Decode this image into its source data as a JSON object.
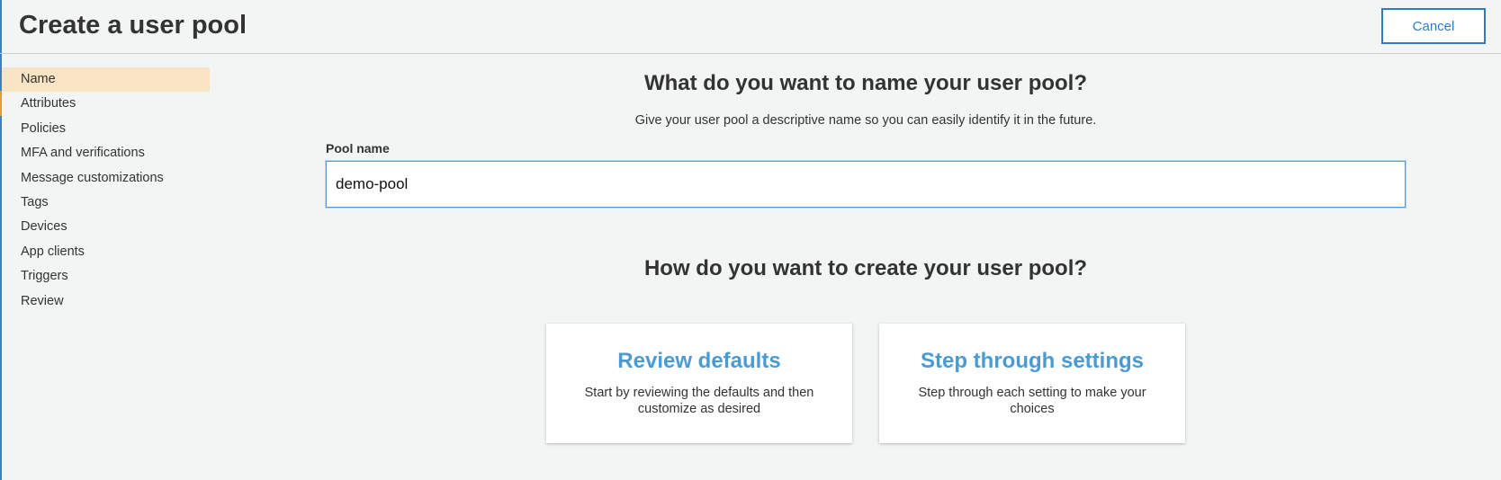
{
  "header": {
    "title": "Create a user pool",
    "cancel_label": "Cancel"
  },
  "sidebar": {
    "active": "Name",
    "items": [
      {
        "label": "Name"
      },
      {
        "label": "Attributes"
      },
      {
        "label": "Policies"
      },
      {
        "label": "MFA and verifications"
      },
      {
        "label": "Message customizations"
      },
      {
        "label": "Tags"
      },
      {
        "label": "Devices"
      },
      {
        "label": "App clients"
      },
      {
        "label": "Triggers"
      },
      {
        "label": "Review"
      }
    ]
  },
  "main": {
    "name_heading": "What do you want to name your user pool?",
    "name_description": "Give your user pool a descriptive name so you can easily identify it in the future.",
    "pool_name_label": "Pool name",
    "pool_name_value": "demo-pool",
    "create_heading": "How do you want to create your user pool?",
    "options": [
      {
        "title": "Review defaults",
        "description": "Start by reviewing the defaults and then customize as desired"
      },
      {
        "title": "Step through settings",
        "description": "Step through each setting to make your choices"
      }
    ]
  },
  "colors": {
    "accent_blue": "#2e7cc6",
    "card_title_blue": "#4a9bd4",
    "active_item_bg": "#f9e5c4",
    "active_marker": "#e89a2c",
    "background": "#f3f5f5"
  }
}
